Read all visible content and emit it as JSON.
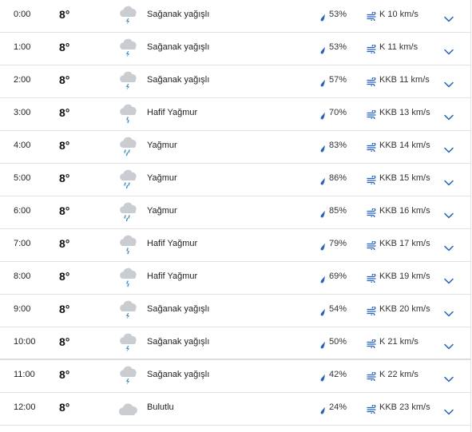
{
  "rows": [
    {
      "time": "0:00",
      "temp": "8°",
      "icon": "heavy-rain-shower-icon",
      "cond": "Sağanak yağışlı",
      "hum": "53%",
      "wind": "K 10 km/s"
    },
    {
      "time": "1:00",
      "temp": "8°",
      "icon": "heavy-rain-shower-icon",
      "cond": "Sağanak yağışlı",
      "hum": "53%",
      "wind": "K 11 km/s"
    },
    {
      "time": "2:00",
      "temp": "8°",
      "icon": "heavy-rain-shower-icon",
      "cond": "Sağanak yağışlı",
      "hum": "57%",
      "wind": "KKB 11 km/s"
    },
    {
      "time": "3:00",
      "temp": "8°",
      "icon": "light-rain-icon",
      "cond": "Hafif Yağmur",
      "hum": "70%",
      "wind": "KKB 13 km/s"
    },
    {
      "time": "4:00",
      "temp": "8°",
      "icon": "rain-icon",
      "cond": "Yağmur",
      "hum": "83%",
      "wind": "KKB 14 km/s"
    },
    {
      "time": "5:00",
      "temp": "8°",
      "icon": "rain-icon",
      "cond": "Yağmur",
      "hum": "86%",
      "wind": "KKB 15 km/s"
    },
    {
      "time": "6:00",
      "temp": "8°",
      "icon": "rain-icon",
      "cond": "Yağmur",
      "hum": "85%",
      "wind": "KKB 16 km/s"
    },
    {
      "time": "7:00",
      "temp": "8°",
      "icon": "light-rain-icon",
      "cond": "Hafif Yağmur",
      "hum": "79%",
      "wind": "KKB 17 km/s"
    },
    {
      "time": "8:00",
      "temp": "8°",
      "icon": "light-rain-icon",
      "cond": "Hafif Yağmur",
      "hum": "69%",
      "wind": "KKB 19 km/s"
    },
    {
      "time": "9:00",
      "temp": "8°",
      "icon": "heavy-rain-shower-icon",
      "cond": "Sağanak yağışlı",
      "hum": "54%",
      "wind": "KKB 20 km/s"
    },
    {
      "time": "10:00",
      "temp": "8°",
      "icon": "heavy-rain-shower-icon",
      "cond": "Sağanak yağışlı",
      "hum": "50%",
      "wind": "K 21 km/s"
    },
    {
      "time": "11:00",
      "temp": "8°",
      "icon": "heavy-rain-shower-icon",
      "cond": "Sağanak yağışlı",
      "hum": "42%",
      "wind": "K 22 km/s"
    },
    {
      "time": "12:00",
      "temp": "8°",
      "icon": "cloudy-icon",
      "cond": "Bulutlu",
      "hum": "24%",
      "wind": "KKB 23 km/s"
    }
  ],
  "colors": {
    "accent": "#2460c8",
    "cloud": "#c9cdd2",
    "rain": "#3b8fd6",
    "text": "#222222"
  }
}
